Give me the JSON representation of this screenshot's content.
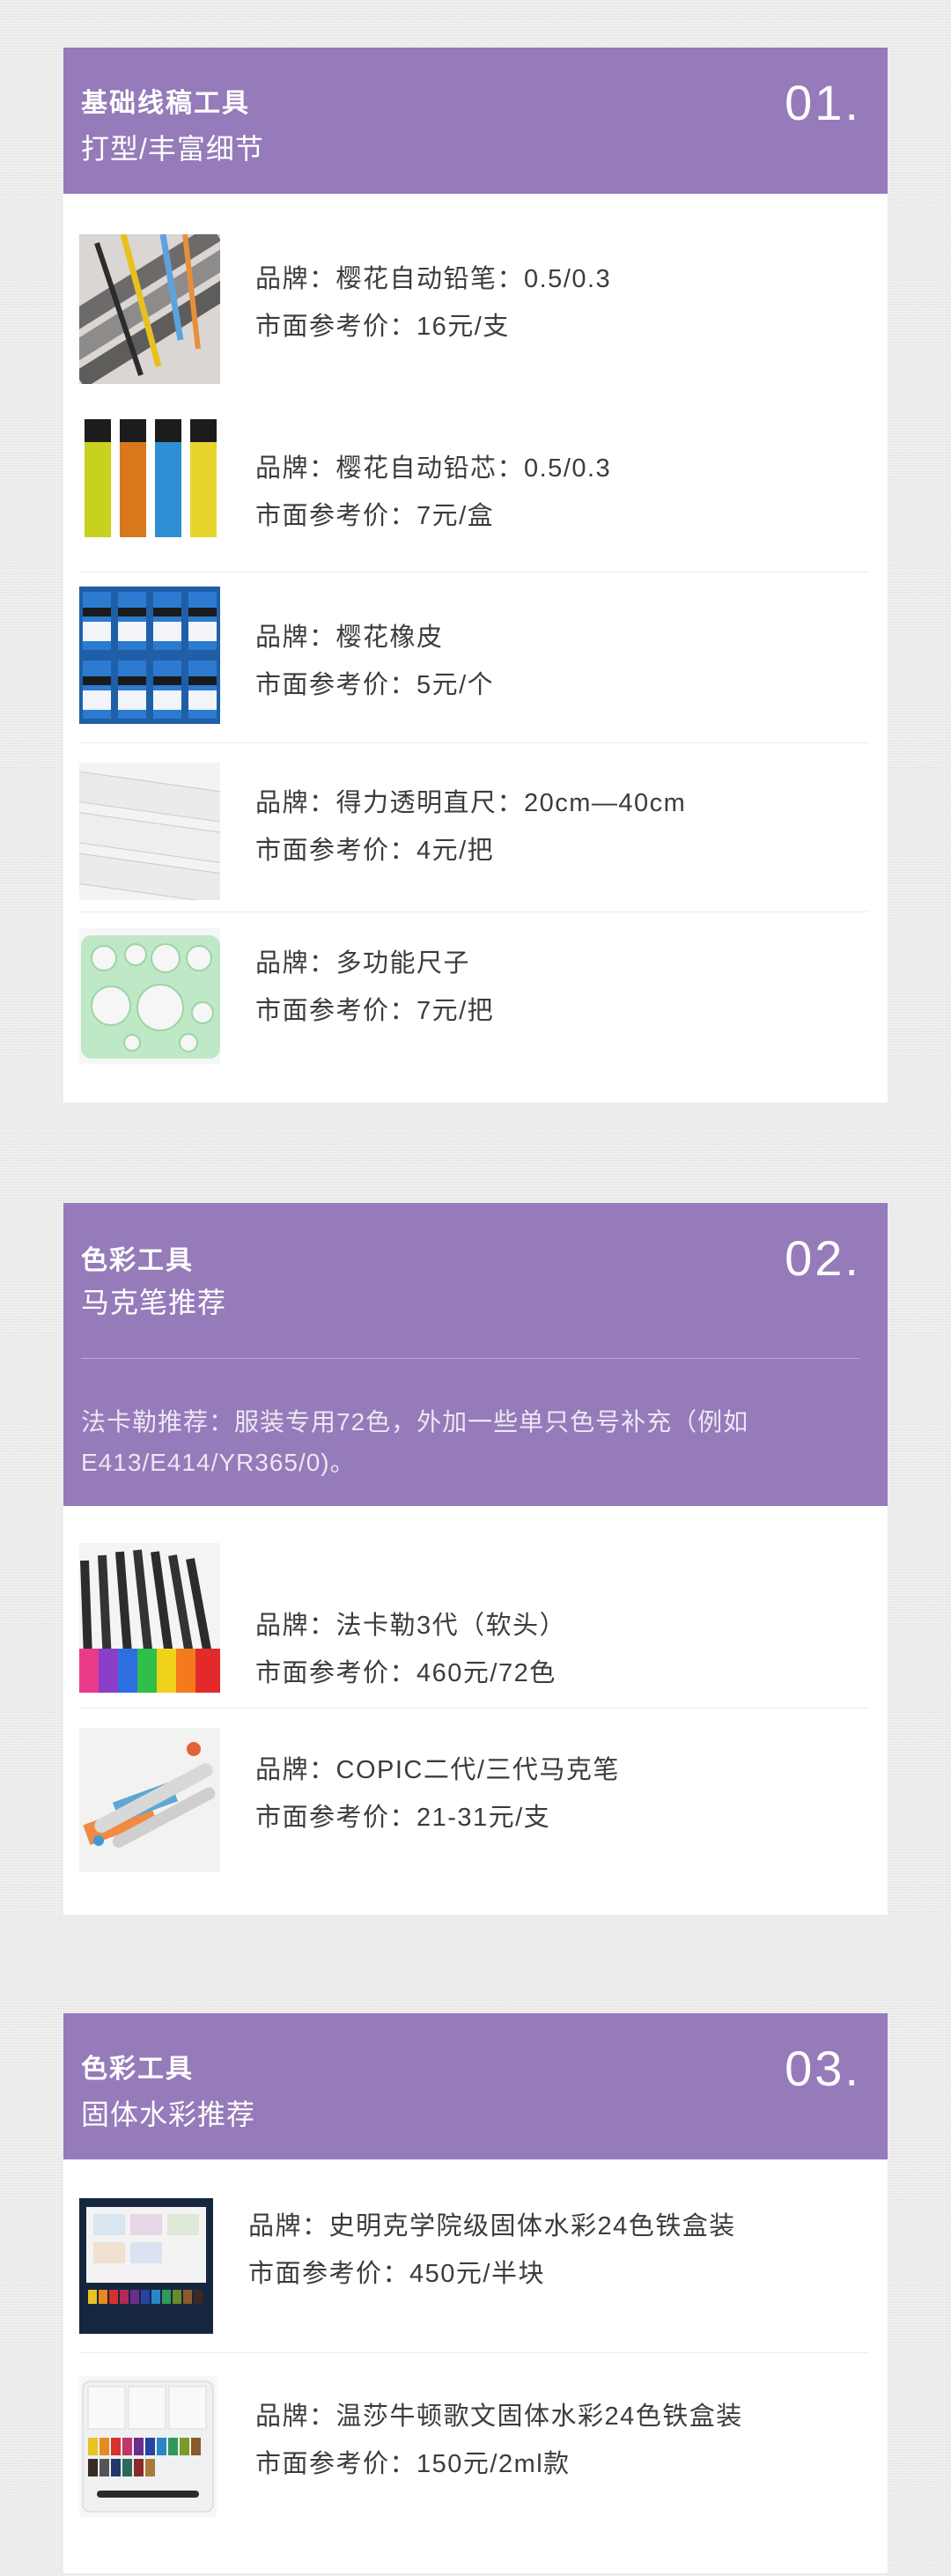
{
  "sections": [
    {
      "title": "基础线稿工具",
      "subtitle": "打型/丰富细节",
      "number": "01.",
      "items": [
        {
          "brand": "品牌：樱花自动铅笔：0.5/0.3",
          "price": "市面参考价：16元/支",
          "image_icon": "mechanical-pencils-icon"
        },
        {
          "brand": "品牌：樱花自动铅芯：0.5/0.3",
          "price": "市面参考价：7元/盒",
          "image_icon": "pencil-leads-icon"
        },
        {
          "brand": "品牌：樱花橡皮",
          "price": "市面参考价：5元/个",
          "image_icon": "erasers-icon"
        },
        {
          "brand": "品牌：得力透明直尺：20cm—40cm",
          "price": "市面参考价：4元/把",
          "image_icon": "transparent-ruler-icon"
        },
        {
          "brand": "品牌：多功能尺子",
          "price": "市面参考价：7元/把",
          "image_icon": "template-ruler-icon"
        }
      ]
    },
    {
      "title": "色彩工具",
      "subtitle": "马克笔推荐",
      "number": "02.",
      "note": "法卡勒推荐：服装专用72色，外加一些单只色号补充（例如E413/E414/YR365/0)。",
      "items": [
        {
          "brand": "品牌：法卡勒3代（软头）",
          "price": "市面参考价：460元/72色",
          "image_icon": "marker-set-icon"
        },
        {
          "brand": "品牌：COPIC二代/三代马克笔",
          "price": "市面参考价：21-31元/支",
          "image_icon": "copic-marker-icon"
        }
      ]
    },
    {
      "title": "色彩工具",
      "subtitle": "固体水彩推荐",
      "number": "03.",
      "items": [
        {
          "brand": "品牌：史明克学院级固体水彩24色铁盒装",
          "price": "市面参考价：450元/半块",
          "image_icon": "watercolor-tin-icon"
        },
        {
          "brand": "品牌：温莎牛顿歌文固体水彩24色铁盒装",
          "price": "市面参考价：150元/2ml款",
          "image_icon": "watercolor-palette-icon"
        }
      ]
    }
  ],
  "colors": {
    "header_purple": "#957bba",
    "page_background": "#ececed",
    "card_white": "#ffffff"
  }
}
